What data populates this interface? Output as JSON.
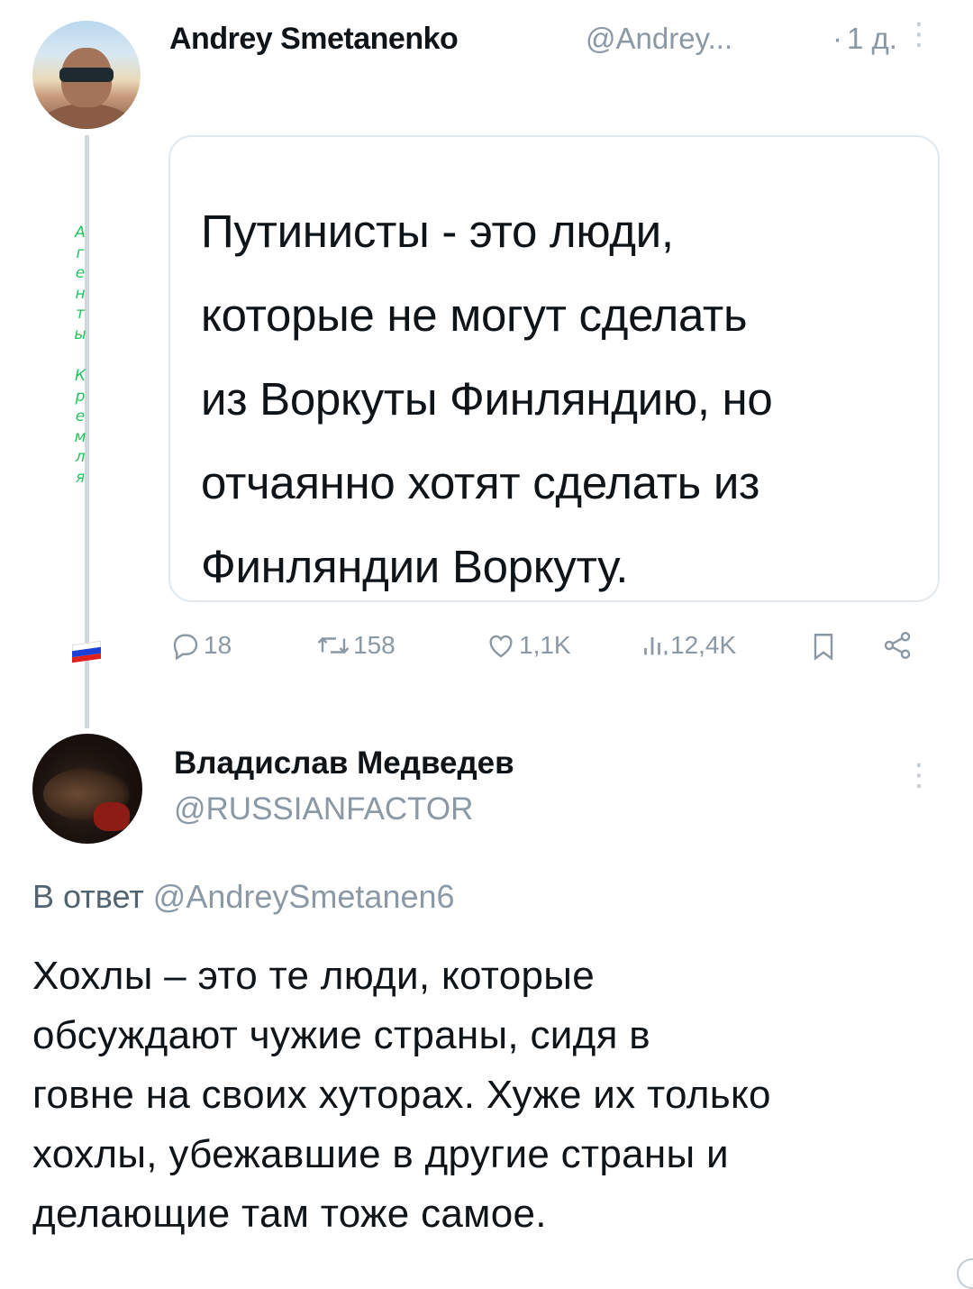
{
  "tweet1": {
    "author_name": "Andrey Smetanenko",
    "handle": "@Andrey...",
    "separator": "·",
    "time": "1 д.",
    "more": "⋮",
    "side_letters": [
      "А",
      "г",
      "е",
      "н",
      "т",
      "ы",
      "",
      "К",
      "р",
      "е",
      "м",
      "л",
      "я"
    ],
    "quote_lines": [
      "Путинисты - это люди,",
      "которые не могут сделать",
      "из Воркуты Финляндию, но",
      "отчаянно хотят сделать из",
      "Финляндии Воркуту."
    ],
    "actions": {
      "replies": "18",
      "reposts": "158",
      "likes": "1,1K",
      "views": "12,4K"
    }
  },
  "flag_colors": [
    "#ffffff",
    "#1c3fd6",
    "#e0201c"
  ],
  "tweet2": {
    "author_name": "Владислав Медведев",
    "handle": "@RUSSIANFACTOR",
    "more": "⋮",
    "reply_prefix": "В ответ",
    "reply_mention": "@AndreySmetanen6",
    "body_lines": [
      "Хохлы – это те люди, которые",
      "обсуждают чужие страны, сидя в",
      "говне на своих хуторах. Хуже их только",
      "хохлы, убежавшие в другие страны и",
      "делающие там тоже самое."
    ]
  },
  "colors": {
    "muted": "#8b98a5",
    "side_letters": "#21c55d",
    "thread_line": "#cfd9de"
  }
}
